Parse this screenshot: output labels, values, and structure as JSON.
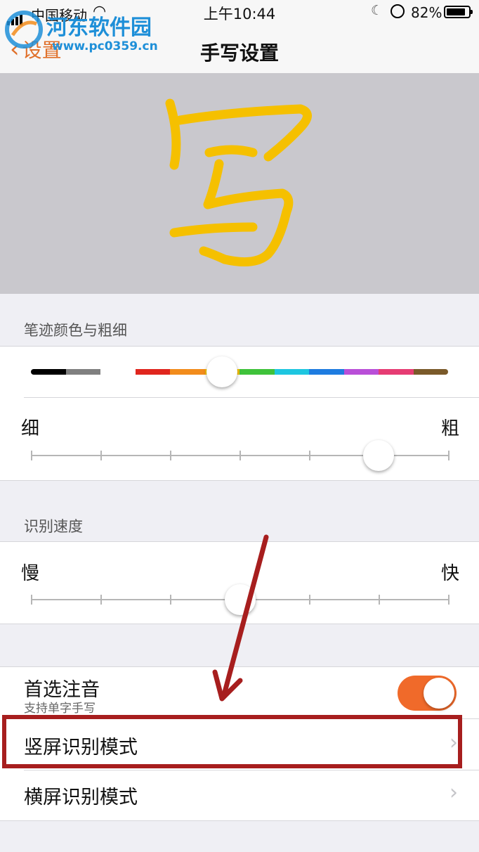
{
  "status_bar": {
    "carrier": "中国移动",
    "time": "上午10:44",
    "battery_percent": "82%",
    "battery_level": 0.82
  },
  "nav": {
    "back_label": "设置",
    "title": "手写设置"
  },
  "watermark": {
    "title": "河东软件园",
    "url": "www.pc0359.cn"
  },
  "canvas": {
    "ink_color": "#f5c000"
  },
  "stroke_section": {
    "header": "笔迹颜色与粗细",
    "palette": [
      "#000000",
      "#808080",
      "#ffffff",
      "#e0261e",
      "#f28c1c",
      "#f5c000",
      "#3fc23a",
      "#1ec6e0",
      "#1e7ce0",
      "#b94fd8",
      "#e63c73",
      "#7a5a2a"
    ],
    "selected_color_index": 5,
    "thin_label": "细",
    "thick_label": "粗",
    "thickness_level": 0.83
  },
  "speed_section": {
    "header": "识别速度",
    "slow_label": "慢",
    "fast_label": "快",
    "speed_level": 0.5
  },
  "settings": {
    "zhuyin_title": "首选注音",
    "zhuyin_subtitle": "支持单字手写",
    "zhuyin_enabled": true,
    "portrait_mode": "竖屏识别模式",
    "landscape_mode": "横屏识别模式"
  },
  "annotation": {
    "color": "#a71e1e"
  }
}
